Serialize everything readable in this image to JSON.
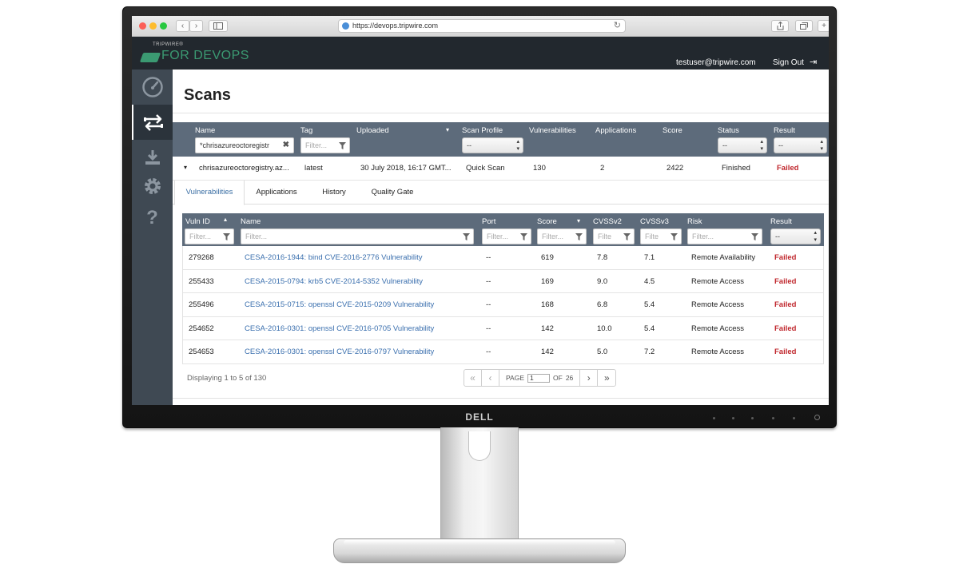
{
  "browser": {
    "url": "https://devops.tripwire.com",
    "back_glyph": "‹",
    "forward_glyph": "›",
    "reload_glyph": "↻"
  },
  "header": {
    "logo_small": "TRIPWIRE®",
    "logo_main": "FOR DEVOPS",
    "user_email": "testuser@tripwire.com",
    "sign_out": "Sign Out",
    "sign_out_glyph": "⇥"
  },
  "sidebar": {
    "items": [
      {
        "icon": "dashboard-gauge-icon"
      },
      {
        "icon": "scans-transfer-icon",
        "active": true
      },
      {
        "icon": "download-icon"
      },
      {
        "icon": "gear-icon"
      },
      {
        "icon": "help-question-icon",
        "glyph": "?"
      }
    ]
  },
  "page": {
    "title": "Scans"
  },
  "scans_table": {
    "columns": {
      "name": "Name",
      "tag": "Tag",
      "uploaded": "Uploaded",
      "scan_profile": "Scan Profile",
      "vulnerabilities": "Vulnerabilities",
      "applications": "Applications",
      "score": "Score",
      "status": "Status",
      "result": "Result"
    },
    "filters": {
      "name_value": "*chrisazureoctoregistr",
      "tag_placeholder": "Filter...",
      "scan_profile_value": "--",
      "status_value": "--",
      "result_value": "--"
    },
    "sort_glyph": "▾",
    "expand_glyph": "▾",
    "row": {
      "name": "chrisazureoctoregistry.az...",
      "tag": "latest",
      "uploaded": "30 July 2018, 16:17 GMT...",
      "scan_profile": "Quick Scan",
      "vulnerabilities": "130",
      "applications": "2",
      "score": "2422",
      "status": "Finished",
      "result": "Failed"
    }
  },
  "tabs": [
    {
      "label": "Vulnerabilities",
      "active": true
    },
    {
      "label": "Applications"
    },
    {
      "label": "History"
    },
    {
      "label": "Quality Gate"
    }
  ],
  "vuln_table": {
    "columns": {
      "vuln_id": "Vuln ID",
      "name": "Name",
      "port": "Port",
      "score": "Score",
      "cvss2": "CVSSv2",
      "cvss3": "CVSSv3",
      "risk": "Risk",
      "result": "Result"
    },
    "placeholders": {
      "vuln_id": "Filter...",
      "name": "Filter...",
      "port": "Filter...",
      "score": "Filter...",
      "cvss2": "Filte",
      "cvss3": "Filte",
      "risk": "Filter...",
      "result": "--"
    },
    "sort_up_glyph": "▴",
    "sort_down_glyph": "▾",
    "filter_glyph": "⧩",
    "rows": [
      {
        "id": "279268",
        "name": "CESA-2016-1944: bind CVE-2016-2776 Vulnerability",
        "port": "--",
        "score": "619",
        "cvss2": "7.8",
        "cvss3": "7.1",
        "risk": "Remote Availability",
        "result": "Failed"
      },
      {
        "id": "255433",
        "name": "CESA-2015-0794: krb5 CVE-2014-5352 Vulnerability",
        "port": "--",
        "score": "169",
        "cvss2": "9.0",
        "cvss3": "4.5",
        "risk": "Remote Access",
        "result": "Failed"
      },
      {
        "id": "255496",
        "name": "CESA-2015-0715: openssl CVE-2015-0209 Vulnerability",
        "port": "--",
        "score": "168",
        "cvss2": "6.8",
        "cvss3": "5.4",
        "risk": "Remote Access",
        "result": "Failed"
      },
      {
        "id": "254652",
        "name": "CESA-2016-0301: openssl CVE-2016-0705 Vulnerability",
        "port": "--",
        "score": "142",
        "cvss2": "10.0",
        "cvss3": "5.4",
        "risk": "Remote Access",
        "result": "Failed"
      },
      {
        "id": "254653",
        "name": "CESA-2016-0301: openssl CVE-2016-0797 Vulnerability",
        "port": "--",
        "score": "142",
        "cvss2": "5.0",
        "cvss3": "7.2",
        "risk": "Remote Access",
        "result": "Failed"
      }
    ]
  },
  "pagination": {
    "display_text": "Displaying 1 to 5 of 130",
    "page_label": "PAGE",
    "current_page": "1",
    "of_label": "OF",
    "total_pages": "26",
    "first_glyph": "«",
    "prev_glyph": "‹",
    "next_glyph": "›",
    "last_glyph": "»"
  },
  "monitor": {
    "brand": "DELL"
  },
  "colors": {
    "header_bg": "#22282e",
    "sidebar_bg": "#3f4953",
    "table_head_bg": "#5d6b7b",
    "failed_red": "#c0272d",
    "link_blue": "#3a6fae",
    "brand_green": "#3b9a72"
  }
}
